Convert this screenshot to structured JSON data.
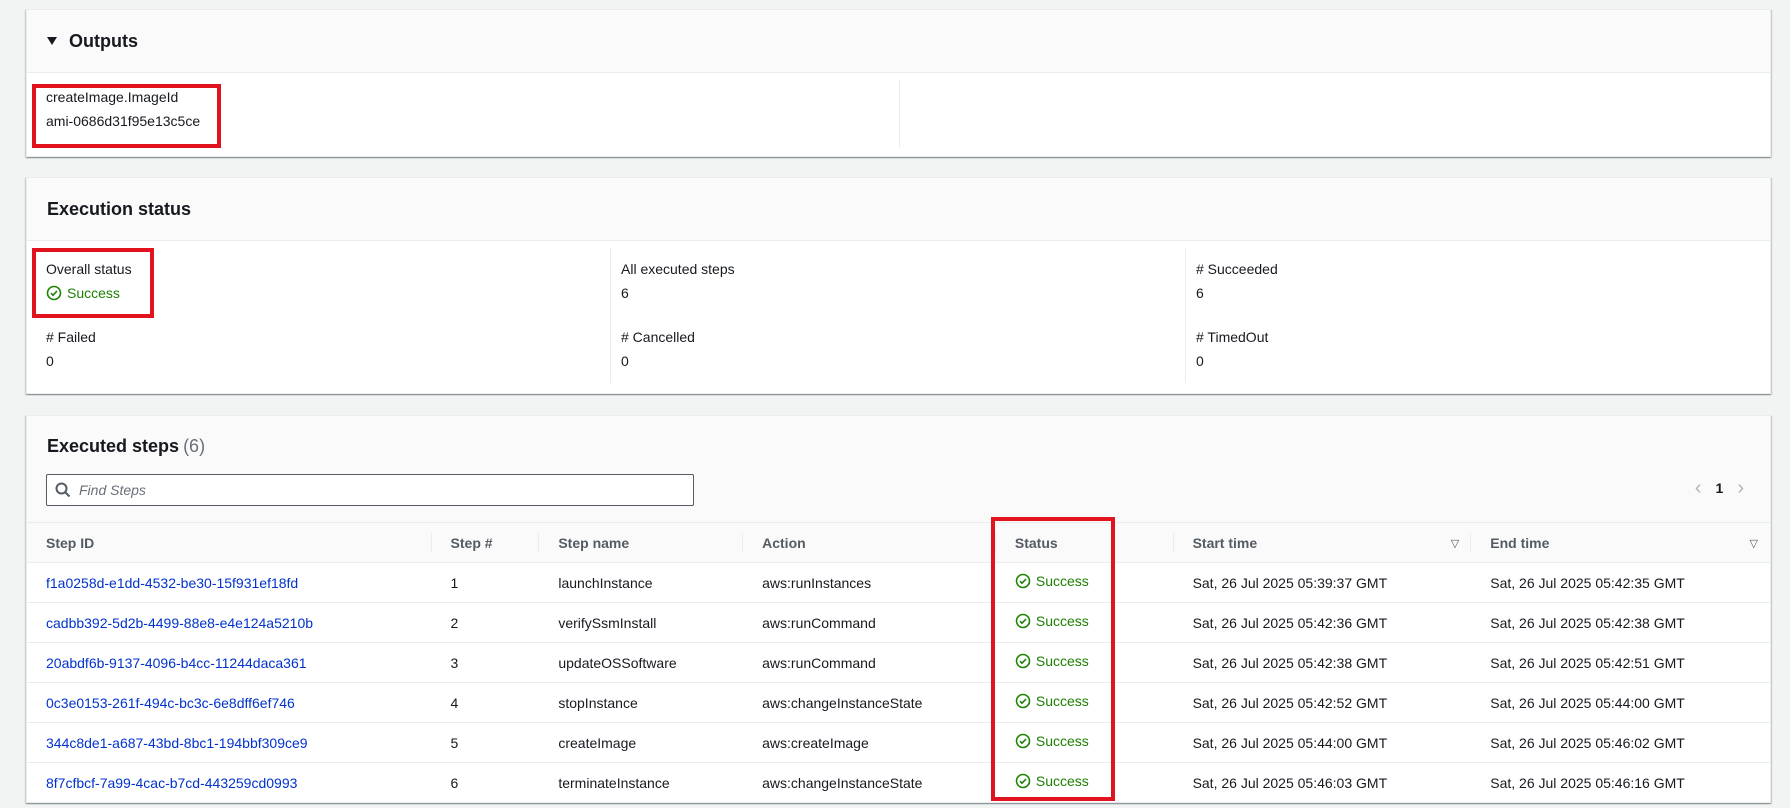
{
  "outputs": {
    "title": "Outputs",
    "key": "createImage.ImageId",
    "value": "ami-0686d31f95e13c5ce"
  },
  "execution_status": {
    "title": "Execution status",
    "overall_label": "Overall status",
    "overall_value": "Success",
    "all_steps_label": "All executed steps",
    "all_steps_value": "6",
    "succeeded_label": "# Succeeded",
    "succeeded_value": "6",
    "failed_label": "# Failed",
    "failed_value": "0",
    "cancelled_label": "# Cancelled",
    "cancelled_value": "0",
    "timedout_label": "# TimedOut",
    "timedout_value": "0"
  },
  "steps": {
    "title": "Executed steps",
    "count": "(6)",
    "search_placeholder": "Find Steps",
    "page": "1",
    "columns": [
      "Step ID",
      "Step #",
      "Step name",
      "Action",
      "Status",
      "Start time",
      "End time"
    ],
    "rows": [
      {
        "id": "f1a0258d-e1dd-4532-be30-15f931ef18fd",
        "num": "1",
        "name": "launchInstance",
        "action": "aws:runInstances",
        "status": "Success",
        "start": "Sat, 26 Jul 2025 05:39:37 GMT",
        "end": "Sat, 26 Jul 2025 05:42:35 GMT"
      },
      {
        "id": "cadbb392-5d2b-4499-88e8-e4e124a5210b",
        "num": "2",
        "name": "verifySsmInstall",
        "action": "aws:runCommand",
        "status": "Success",
        "start": "Sat, 26 Jul 2025 05:42:36 GMT",
        "end": "Sat, 26 Jul 2025 05:42:38 GMT"
      },
      {
        "id": "20abdf6b-9137-4096-b4cc-11244daca361",
        "num": "3",
        "name": "updateOSSoftware",
        "action": "aws:runCommand",
        "status": "Success",
        "start": "Sat, 26 Jul 2025 05:42:38 GMT",
        "end": "Sat, 26 Jul 2025 05:42:51 GMT"
      },
      {
        "id": "0c3e0153-261f-494c-bc3c-6e8dff6ef746",
        "num": "4",
        "name": "stopInstance",
        "action": "aws:changeInstanceState",
        "status": "Success",
        "start": "Sat, 26 Jul 2025 05:42:52 GMT",
        "end": "Sat, 26 Jul 2025 05:44:00 GMT"
      },
      {
        "id": "344c8de1-a687-43bd-8bc1-194bbf309ce9",
        "num": "5",
        "name": "createImage",
        "action": "aws:createImage",
        "status": "Success",
        "start": "Sat, 26 Jul 2025 05:44:00 GMT",
        "end": "Sat, 26 Jul 2025 05:46:02 GMT"
      },
      {
        "id": "8f7cfbcf-7a99-4cac-b7cd-443259cd0993",
        "num": "6",
        "name": "terminateInstance",
        "action": "aws:changeInstanceState",
        "status": "Success",
        "start": "Sat, 26 Jul 2025 05:46:03 GMT",
        "end": "Sat, 26 Jul 2025 05:46:16 GMT"
      }
    ]
  },
  "icons": {
    "success": "check-circle-icon",
    "search": "search-icon",
    "caret": "caret-down-icon",
    "sort": "sort-down-icon",
    "prev": "chevron-left-icon",
    "next": "chevron-right-icon"
  },
  "colors": {
    "success": "#1d8102",
    "link": "#0033cc",
    "highlight": "#e0131f"
  }
}
